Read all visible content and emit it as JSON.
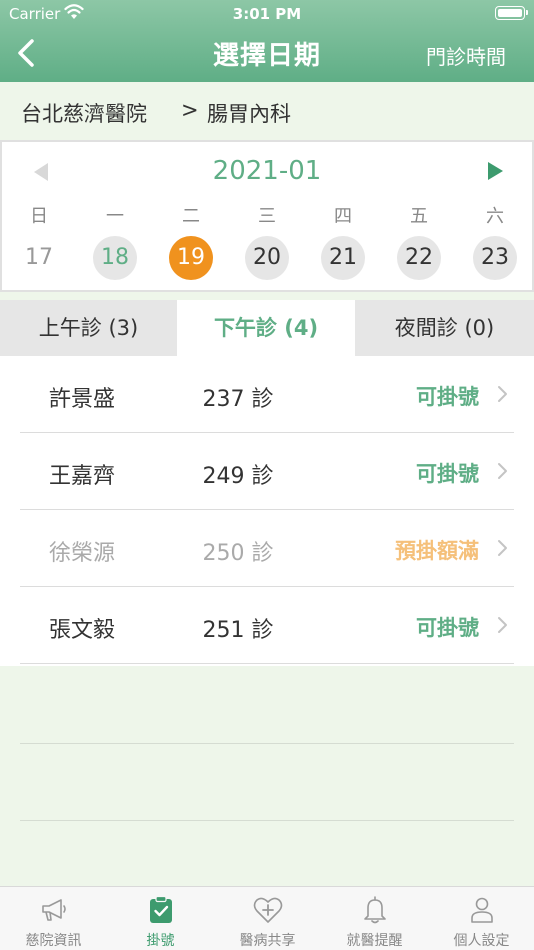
{
  "status_bar": {
    "carrier": "Carrier",
    "time": "3:01 PM"
  },
  "header": {
    "title": "選擇日期",
    "right_action": "門診時間"
  },
  "breadcrumb": {
    "hospital": "台北慈濟醫院",
    "separator": ">",
    "department": "腸胃內科"
  },
  "calendar": {
    "month": "2021-01",
    "weekdays": [
      "日",
      "一",
      "二",
      "三",
      "四",
      "五",
      "六"
    ],
    "days": [
      "17",
      "18",
      "19",
      "20",
      "21",
      "22",
      "23"
    ]
  },
  "tabs": [
    {
      "label": "上午診 (3)"
    },
    {
      "label": "下午診 (4)"
    },
    {
      "label": "夜間診 (0)"
    }
  ],
  "clinics": [
    {
      "name": "許景盛",
      "room": "237 診",
      "status": "可掛號"
    },
    {
      "name": "王嘉齊",
      "room": "249 診",
      "status": "可掛號"
    },
    {
      "name": "徐榮源",
      "room": "250 診",
      "status": "預掛額滿"
    },
    {
      "name": "張文毅",
      "room": "251 診",
      "status": "可掛號"
    }
  ],
  "tabbar": [
    {
      "label": "慈院資訊",
      "icon": "megaphone-icon"
    },
    {
      "label": "掛號",
      "icon": "clipboard-check-icon"
    },
    {
      "label": "醫病共享",
      "icon": "heart-plus-icon"
    },
    {
      "label": "就醫提醒",
      "icon": "bell-icon"
    },
    {
      "label": "個人設定",
      "icon": "person-icon"
    }
  ],
  "colors": {
    "accent": "#5fae86",
    "selected_day": "#f0921e",
    "full_status": "#f5c07a"
  }
}
